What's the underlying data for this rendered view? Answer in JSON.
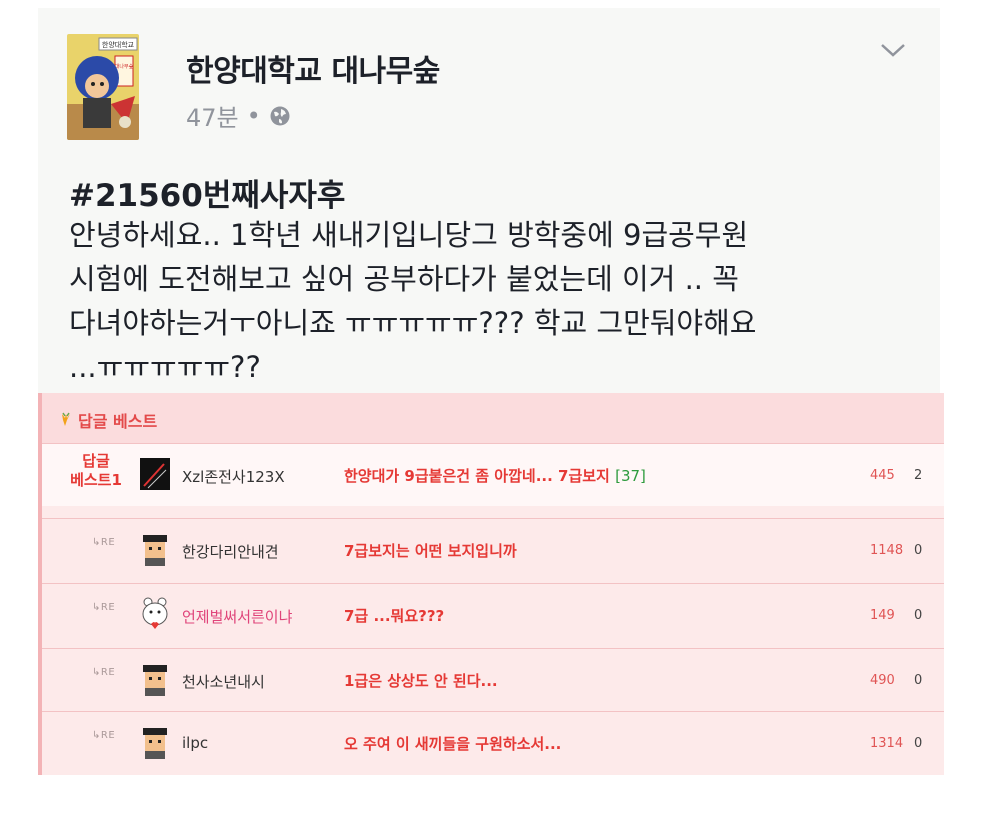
{
  "post": {
    "page_name": "한양대학교 대나무숲",
    "time": "47분",
    "separator": "•",
    "tag": "#21560번째사자후",
    "body_lines": [
      "안녕하세요.. 1학년 새내기입니당그 방학중에 9급공무원",
      "시험에 도전해보고 싶어 공부하다가 붙었는데 이거 .. 꼭",
      "다녀야하는거ㅜ아니죠 ㅠㅠㅠㅠㅠ??? 학교 그만둬야해요",
      "...ㅠㅠㅠㅠㅠ??"
    ],
    "avatar_sign": [
      "한양대학교"
    ],
    "avatar_board": "대나무숲",
    "icons": {
      "globe": "globe-icon",
      "chevron": "chevron-down-icon"
    }
  },
  "comments": {
    "title": "답글 베스트",
    "best_badge_line1": "답글",
    "best_badge_line2": "베스트1",
    "re_label": "RE",
    "rows": [
      {
        "user": "Xzl존전사123X",
        "text": "한양대가 9급붙은건 좀 아깝네... 7급보지",
        "count": "[37]",
        "views": "445",
        "num": "2"
      },
      {
        "user": "한강다리안내견",
        "text": "7급보지는 어떤 보지입니까",
        "count": "",
        "views": "1148",
        "num": "0"
      },
      {
        "user": "언제벌써서른이냐",
        "text": "7급 ...뭐요???",
        "count": "",
        "views": "149",
        "num": "0"
      },
      {
        "user": "천사소년내시",
        "text": "1급은 상상도 안 된다...",
        "count": "",
        "views": "490",
        "num": "0"
      },
      {
        "user": "ilpc",
        "text": "오 주여 이 새끼들을 구원하소서...",
        "count": "",
        "views": "1314",
        "num": "0"
      }
    ]
  },
  "colors": {
    "accent_red": "#e53935",
    "board_bg": "#fdeaea",
    "meta_gray": "#90949c"
  }
}
